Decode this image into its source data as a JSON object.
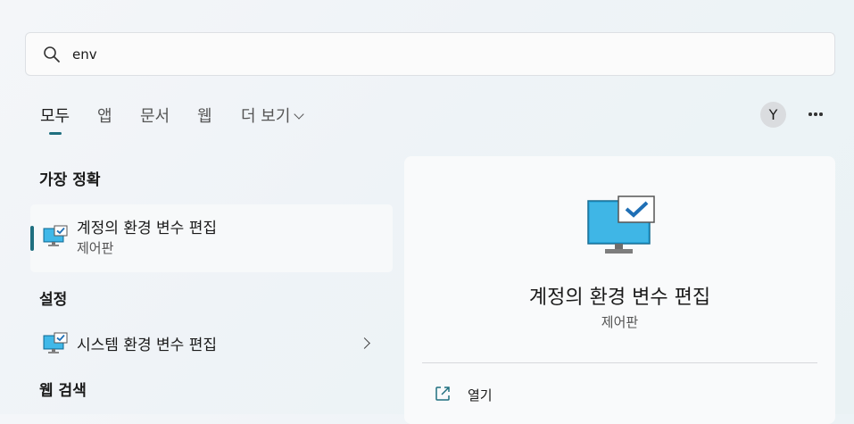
{
  "search": {
    "value": "env",
    "icon": "search-icon"
  },
  "tabs": [
    {
      "label": "모두",
      "active": true
    },
    {
      "label": "앱"
    },
    {
      "label": "문서"
    },
    {
      "label": "웹"
    },
    {
      "label": "더 보기"
    }
  ],
  "header": {
    "avatar_initial": "Y",
    "more_icon": "more-dots-icon"
  },
  "best_match": {
    "heading": "가장 정확",
    "item": {
      "title": "계정의 환경 변수 편집",
      "subtitle": "제어판",
      "icon": "control-panel-monitor-icon"
    }
  },
  "settings": {
    "heading": "설정",
    "item": {
      "title": "시스템 환경 변수 편집",
      "icon": "control-panel-monitor-icon"
    }
  },
  "web_search": {
    "heading": "웹 검색"
  },
  "detail": {
    "title": "계정의 환경 변수 편집",
    "subtitle": "제어판",
    "actions": [
      {
        "label": "열기",
        "icon": "open-external-icon"
      }
    ]
  },
  "colors": {
    "accent": "#1f6f7f",
    "icon_blue": "#2aa7dd"
  }
}
